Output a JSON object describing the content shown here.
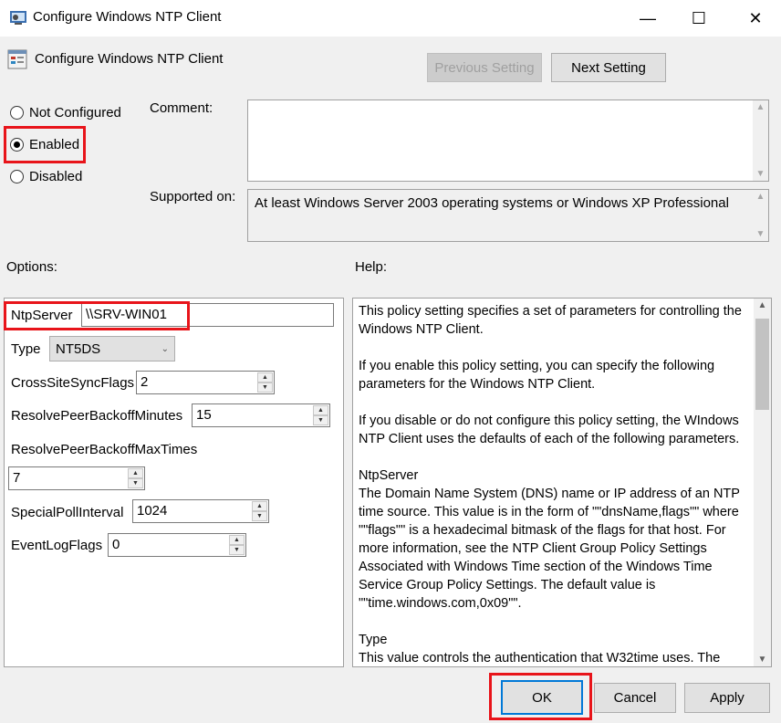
{
  "window": {
    "title": "Configure Windows NTP Client",
    "minimize_glyph": "—",
    "maximize_glyph": "☐",
    "close_glyph": "✕"
  },
  "header": {
    "title": "Configure Windows NTP Client",
    "previous_label": "Previous Setting",
    "next_label": "Next Setting"
  },
  "state": {
    "options": [
      "Not Configured",
      "Enabled",
      "Disabled"
    ],
    "selected": "Enabled"
  },
  "comment": {
    "label": "Comment:",
    "value": ""
  },
  "supported": {
    "label": "Supported on:",
    "value": "At least Windows Server 2003 operating systems or Windows XP Professional"
  },
  "options_panel": {
    "label": "Options:",
    "ntpserver": {
      "label": "NtpServer",
      "value": "\\\\SRV-WIN01"
    },
    "type": {
      "label": "Type",
      "value": "NT5DS"
    },
    "crosssite": {
      "label": "CrossSiteSyncFlags",
      "value": "2"
    },
    "backoff_minutes": {
      "label": "ResolvePeerBackoffMinutes",
      "value": "15"
    },
    "backoff_max": {
      "label": "ResolvePeerBackoffMaxTimes",
      "value": "7"
    },
    "poll": {
      "label": "SpecialPollInterval",
      "value": "1024"
    },
    "eventlog": {
      "label": "EventLogFlags",
      "value": "0"
    }
  },
  "help_panel": {
    "label": "Help:",
    "paragraphs": [
      "This policy setting specifies a set of parameters for controlling the Windows NTP Client.",
      "If you enable this policy setting, you can specify the following parameters for the Windows NTP Client.",
      "If you disable or do not configure this policy setting, the WIndows NTP Client uses the defaults of each of the following parameters.",
      "NtpServer\nThe Domain Name System (DNS) name or IP address of an NTP time source. This value is in the form of \"\"dnsName,flags\"\" where \"\"flags\"\" is a hexadecimal bitmask of the flags for that host. For more information, see the NTP Client Group Policy Settings Associated with Windows Time section of the Windows Time Service Group Policy Settings.  The default value is \"\"time.windows.com,0x09\"\".",
      "Type\nThis value controls the authentication that W32time uses. The"
    ]
  },
  "footer": {
    "ok_label": "OK",
    "cancel_label": "Cancel",
    "apply_label": "Apply"
  },
  "colors": {
    "highlight": "#e8141a",
    "focus": "#0078d7"
  }
}
